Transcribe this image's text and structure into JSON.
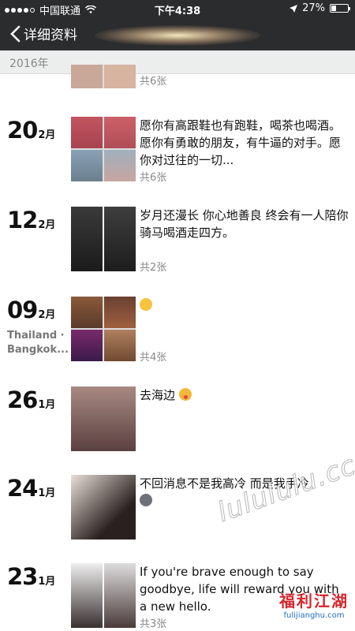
{
  "status_bar": {
    "carrier": "中国联通",
    "time": "下午4:38",
    "battery": "27%",
    "battery_level": 0.27
  },
  "nav": {
    "back_label": "详细资料"
  },
  "year_header": "2016年",
  "entries": [
    {
      "day": "",
      "month": "",
      "location": "",
      "text": "",
      "count": "共6张"
    },
    {
      "day": "20",
      "month": "2月",
      "location": "",
      "text": "愿你有高跟鞋也有跑鞋，喝茶也喝酒。愿你有勇敢的朋友，有牛逼的对手。愿你对过往的一切...",
      "count": "共6张"
    },
    {
      "day": "12",
      "month": "2月",
      "location": "",
      "text": "岁月还漫长 你心地善良 终会有一人陪你骑马喝酒走四方。",
      "count": "共2张"
    },
    {
      "day": "09",
      "month": "2月",
      "location": "Thailand · Bangkok...",
      "text": "",
      "count": "共4张"
    },
    {
      "day": "26",
      "month": "1月",
      "location": "",
      "text": "去海边",
      "count": ""
    },
    {
      "day": "24",
      "month": "1月",
      "location": "",
      "text": "不回消息不是我高冷 而是我手冷",
      "count": ""
    },
    {
      "day": "23",
      "month": "1月",
      "location": "",
      "text": "If you're brave enough to say goodbye, life will reward you with a new hello.",
      "count": "共3张"
    }
  ],
  "watermark": "lulululu.cc",
  "brand": {
    "cn": "福利江湖",
    "en": "fulijianghu.com"
  },
  "colors": {
    "header_bg": "#2a2c2e",
    "year_bar_bg": "#eceded",
    "count_text": "#888888"
  }
}
